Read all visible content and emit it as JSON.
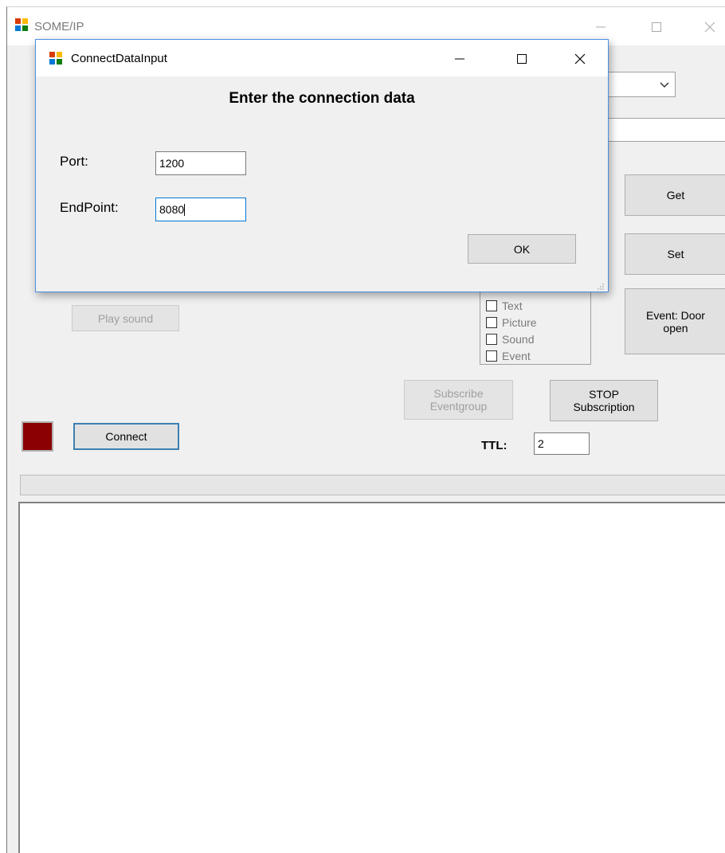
{
  "main_window": {
    "title": "SOME/IP",
    "buttons": {
      "get": "Get",
      "set": "Set",
      "event_door": "Event: Door open",
      "play_sound": "Play sound",
      "subscribe_eventgroup": "Subscribe Eventgroup",
      "stop_subscription": "STOP Subscription",
      "connect": "Connect"
    },
    "checkboxes": [
      {
        "label": "Text",
        "checked": false
      },
      {
        "label": "Picture",
        "checked": false
      },
      {
        "label": "Sound",
        "checked": false
      },
      {
        "label": "Event",
        "checked": false
      }
    ],
    "ttl": {
      "label": "TTL:",
      "value": "2"
    },
    "status_color": "#8b0000"
  },
  "dialog": {
    "title": "ConnectDataInput",
    "heading": "Enter the connection data",
    "port": {
      "label": "Port:",
      "value": "1200"
    },
    "endpoint": {
      "label": "EndPoint:",
      "value": "8080"
    },
    "ok_label": "OK"
  },
  "icons": {
    "app": "winforms-app-icon",
    "minimize": "minimize-icon",
    "maximize": "maximize-icon",
    "close": "close-icon",
    "dropdown": "chevron-down-icon"
  }
}
